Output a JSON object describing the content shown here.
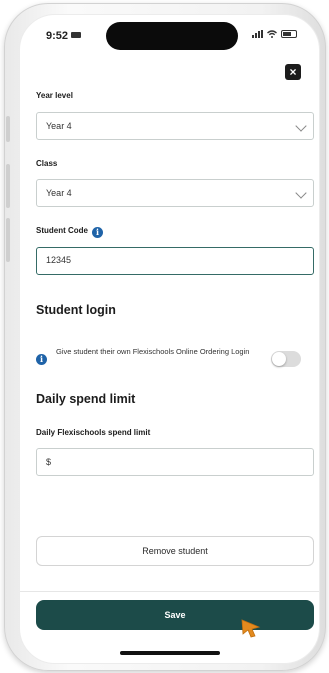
{
  "status_bar": {
    "time": "9:52"
  },
  "form": {
    "year_level": {
      "label": "Year level",
      "value": "Year 4"
    },
    "class": {
      "label": "Class",
      "value": "Year 4"
    },
    "student_code": {
      "label": "Student Code",
      "value": "12345"
    }
  },
  "student_login": {
    "title": "Student login",
    "description": "Give student their own Flexischools Online Ordering Login",
    "toggle_state": "off"
  },
  "daily_spend": {
    "title": "Daily spend limit",
    "label": "Daily Flexischools spend limit",
    "value": "$"
  },
  "actions": {
    "remove_label": "Remove student",
    "save_label": "Save"
  },
  "icons": {
    "close": "close-icon",
    "info": "info-icon",
    "cursor": "pointer-cursor-icon"
  },
  "colors": {
    "primary": "#1c4b49",
    "info": "#1f63a8",
    "cursor": "#e38a1e"
  }
}
